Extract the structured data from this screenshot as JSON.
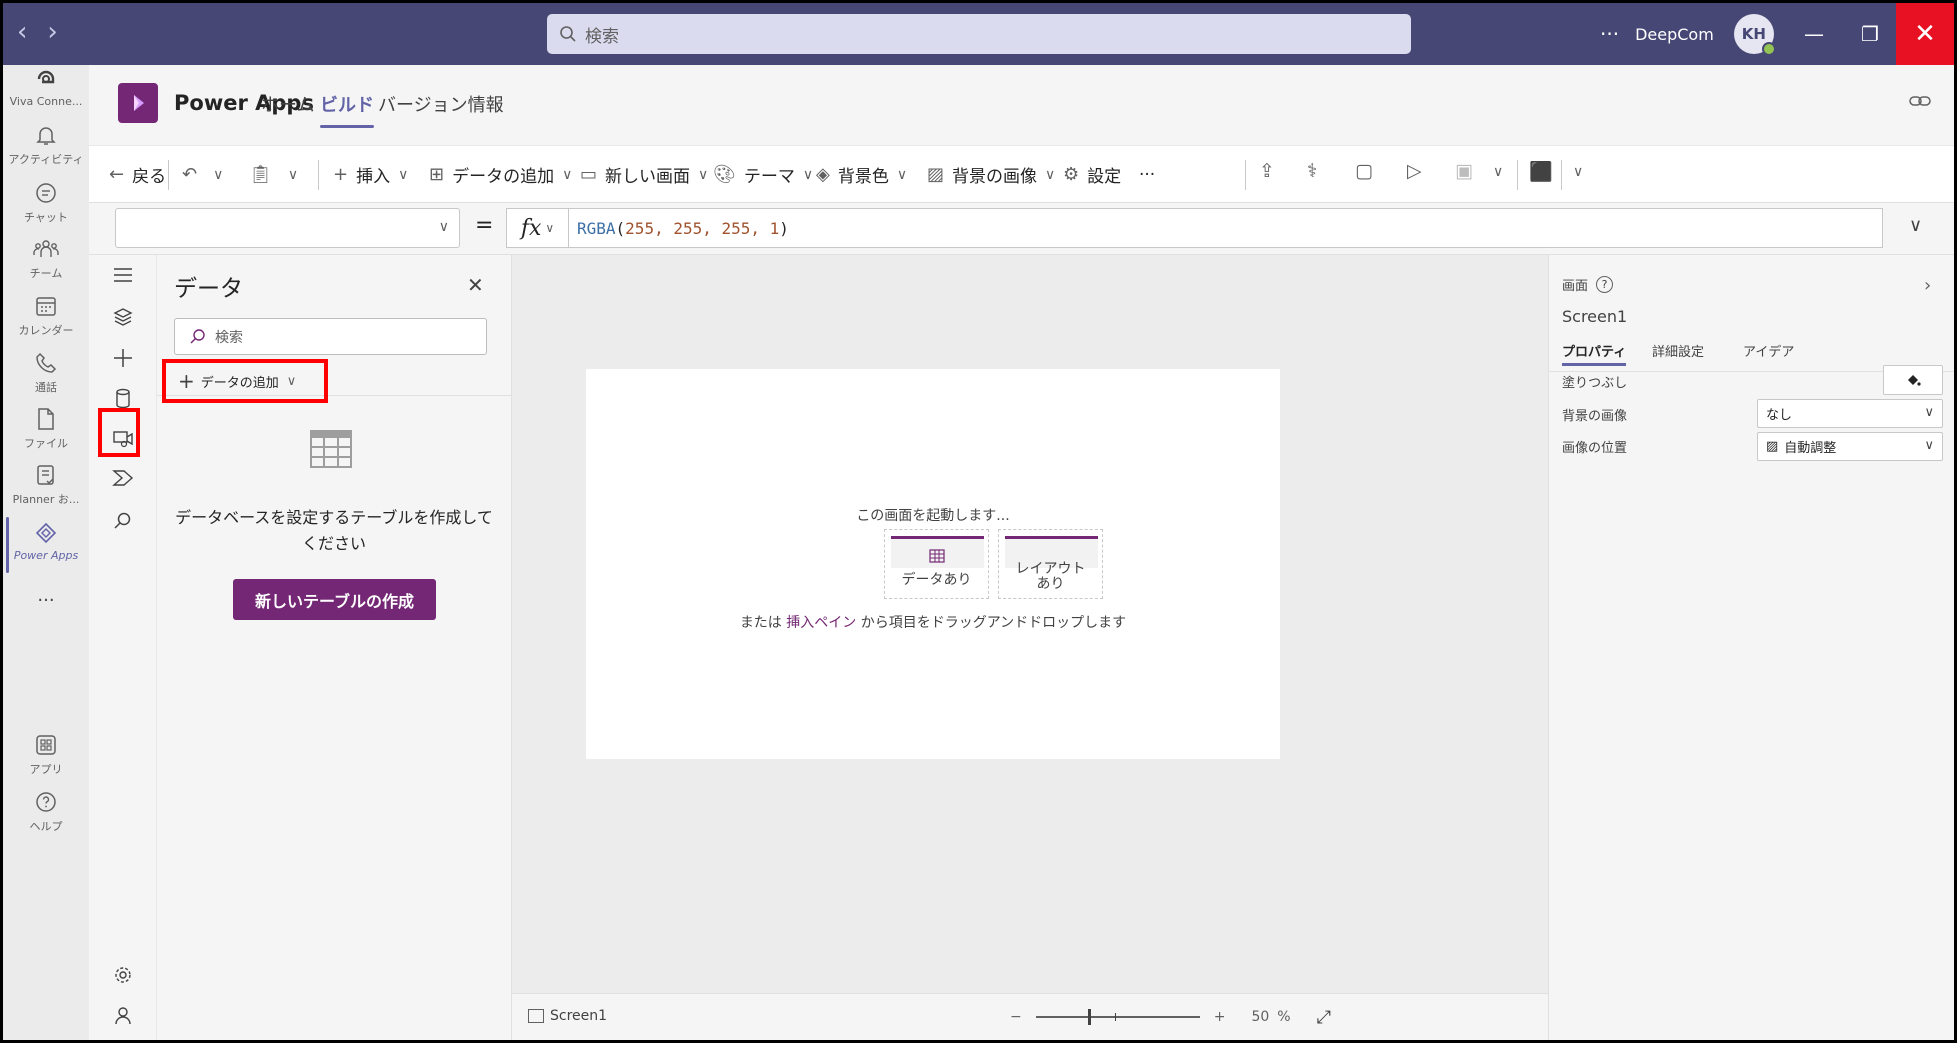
{
  "titlebar": {
    "search_placeholder": "検索",
    "more": "···",
    "org_name": "DeepCom",
    "avatar_initials": "KH"
  },
  "rail": {
    "items": [
      {
        "label": "Viva Conne...",
        "icon": "viva-connections-icon"
      },
      {
        "label": "アクティビティ",
        "icon": "bell-icon"
      },
      {
        "label": "チャット",
        "icon": "chat-icon"
      },
      {
        "label": "チーム",
        "icon": "teams-icon"
      },
      {
        "label": "カレンダー",
        "icon": "calendar-icon"
      },
      {
        "label": "通話",
        "icon": "phone-icon"
      },
      {
        "label": "ファイル",
        "icon": "file-icon"
      },
      {
        "label": "Planner お...",
        "icon": "planner-icon"
      },
      {
        "label": "Power Apps",
        "icon": "power-apps-icon"
      }
    ],
    "more": "...",
    "apps_label": "アプリ",
    "help_label": "ヘルプ"
  },
  "app": {
    "name": "Power Apps",
    "tabs": [
      "ホーム",
      "ビルド",
      "バージョン情報"
    ]
  },
  "commandbar": {
    "back": "戻る",
    "insert": "挿入",
    "add_data": "データの追加",
    "new_screen": "新しい画面",
    "theme": "テーマ",
    "bg_color": "背景色",
    "bg_image": "背景の画像",
    "settings": "設定",
    "more": "···"
  },
  "formula": {
    "fx": "fx",
    "eq": "=",
    "fn": "RGBA",
    "args": "255, 255, 255, 1"
  },
  "datapane": {
    "title": "データ",
    "search_placeholder": "検索",
    "add_data": "データの追加",
    "message": "データベースを設定するテーブルを作成してください",
    "create_button": "新しいテーブルの作成"
  },
  "canvas": {
    "start_text": "この画面を起動します...",
    "cards": [
      "データあり",
      "レイアウトあり"
    ],
    "hint_prefix": "または",
    "hint_link": "挿入ペイン",
    "hint_suffix": "から項目をドラッグアンドドロップします"
  },
  "statusbar": {
    "screen_name": "Screen1",
    "zoom_minus": "−",
    "zoom_plus": "+",
    "zoom_value": "50",
    "zoom_unit": "%"
  },
  "properties": {
    "type_label": "画面",
    "screen_name": "Screen1",
    "tabs": [
      "プロパティ",
      "詳細設定",
      "アイデア"
    ],
    "fill_label": "塗りつぶし",
    "bg_image_label": "背景の画像",
    "bg_image_value": "なし",
    "image_position_label": "画像の位置",
    "image_position_value": "自動調整"
  },
  "colors": {
    "teams_purple": "#464775",
    "powerapps_purple": "#742774",
    "accent": "#6264a7",
    "highlight": "#ff0000"
  }
}
